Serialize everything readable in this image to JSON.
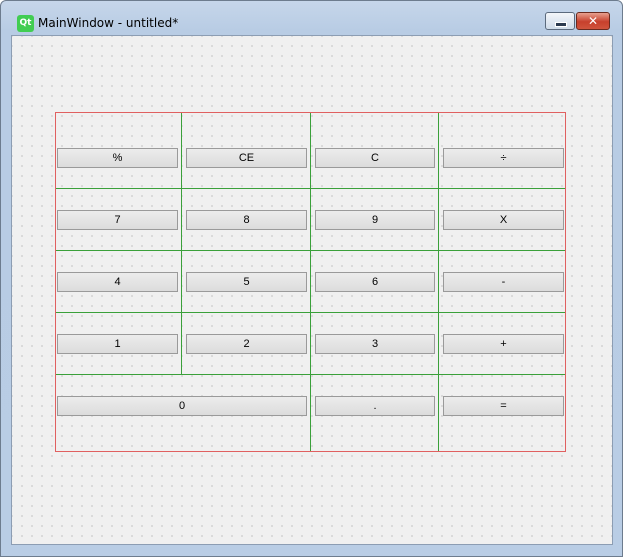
{
  "window": {
    "app_icon": "qt-logo-icon",
    "app_icon_text": "Qt",
    "title": "MainWindow - untitled*",
    "minimize_icon": "minimize-icon",
    "close_icon": "close-icon",
    "close_glyph": "✕"
  },
  "calculator": {
    "rows": [
      [
        "%",
        "CE",
        "C",
        "÷"
      ],
      [
        "7",
        "8",
        "9",
        "X"
      ],
      [
        "4",
        "5",
        "6",
        "-"
      ],
      [
        "1",
        "2",
        "3",
        "+"
      ],
      [
        "0",
        ".",
        "="
      ]
    ]
  },
  "colors": {
    "layout_border": "#e06060",
    "grid_lines": "#3aa03a",
    "canvas": "#f0f0f0"
  }
}
